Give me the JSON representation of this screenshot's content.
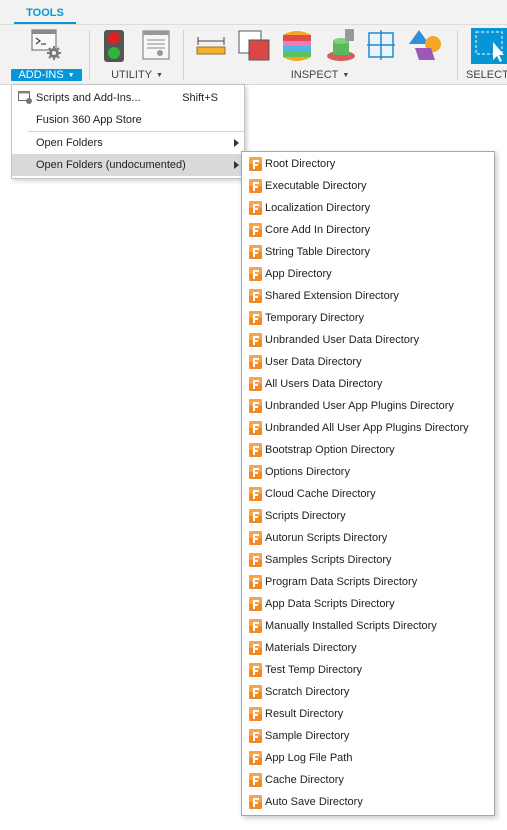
{
  "ribbon": {
    "active_tab": "TOOLS",
    "groups": {
      "addins": "ADD-INS",
      "utility": "UTILITY",
      "inspect": "INSPECT",
      "select": "SELECT"
    },
    "accent_color": "#0696d7"
  },
  "menu": {
    "items": [
      {
        "label": "Scripts and Add-Ins...",
        "shortcut": "Shift+S",
        "icon": "scripts-addins-icon"
      },
      {
        "label": "Fusion 360 App Store"
      },
      {
        "label": "Open Folders",
        "has_submenu": true
      },
      {
        "label": "Open Folders (undocumented)",
        "has_submenu": true,
        "highlighted": true
      }
    ]
  },
  "submenu": {
    "icon": "fusion-f-icon",
    "items": [
      "Root Directory",
      "Executable Directory",
      "Localization Directory",
      "Core Add In Directory",
      "String Table Directory",
      "App Directory",
      "Shared Extension Directory",
      "Temporary Directory",
      "Unbranded User Data Directory",
      "User Data Directory",
      "All Users Data Directory",
      "Unbranded User App Plugins Directory",
      "Unbranded All User App Plugins Directory",
      "Bootstrap Option Directory",
      "Options Directory",
      "Cloud Cache Directory",
      "Scripts Directory",
      "Autorun Scripts Directory",
      "Samples Scripts Directory",
      "Program Data Scripts Directory",
      "App Data Scripts Directory",
      "Manually Installed Scripts Directory",
      "Materials Directory",
      "Test Temp Directory",
      "Scratch Directory",
      "Result Directory",
      "Sample Directory",
      "App Log File Path",
      "Cache Directory",
      "Auto Save Directory"
    ]
  }
}
